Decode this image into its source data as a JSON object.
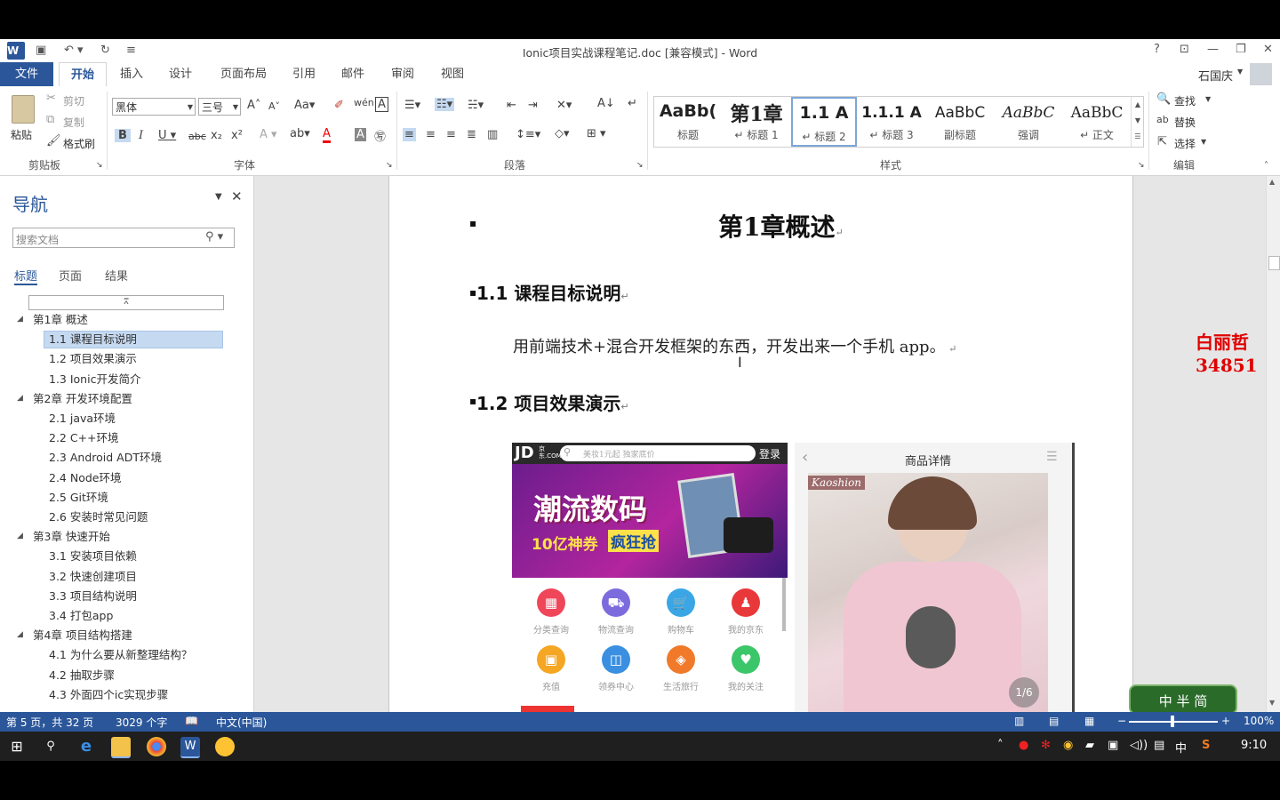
{
  "titlebar": {
    "title": "Ionic项目实战课程笔记.doc [兼容模式] - Word",
    "help": "?",
    "user": "石国庆"
  },
  "ribbon_tabs": [
    "文件",
    "开始",
    "插入",
    "设计",
    "页面布局",
    "引用",
    "邮件",
    "审阅",
    "视图"
  ],
  "clipboard": {
    "paste": "粘贴",
    "cut": "剪切",
    "copy": "复制",
    "format_painter": "格式刷",
    "label": "剪贴板"
  },
  "font": {
    "name": "黑体",
    "size": "三号",
    "label": "字体"
  },
  "paragraph": {
    "label": "段落"
  },
  "styles": {
    "label": "样式",
    "items": [
      {
        "preview": "AaBb(",
        "name": "标题"
      },
      {
        "preview": "第1章",
        "name": "↵ 标题 1"
      },
      {
        "preview": "1.1 A",
        "name": "↵ 标题 2"
      },
      {
        "preview": "1.1.1 A",
        "name": "↵ 标题 3"
      },
      {
        "preview": "AaBbC",
        "name": "副标题"
      },
      {
        "preview": "AaBbC",
        "name": "强调"
      },
      {
        "preview": "AaBbC",
        "name": "↵ 正文"
      }
    ]
  },
  "editing": {
    "find": "查找",
    "replace": "替换",
    "select": "选择",
    "label": "编辑"
  },
  "nav": {
    "title": "导航",
    "search_placeholder": "搜索文档",
    "tabs": [
      "标题",
      "页面",
      "结果"
    ],
    "tree": [
      {
        "text": "第1章 概述",
        "level": 0
      },
      {
        "text": "1.1 课程目标说明",
        "level": 1,
        "selected": true
      },
      {
        "text": "1.2 项目效果演示",
        "level": 1
      },
      {
        "text": "1.3 Ionic开发简介",
        "level": 1
      },
      {
        "text": "第2章 开发环境配置",
        "level": 0
      },
      {
        "text": "2.1 java环境",
        "level": 1
      },
      {
        "text": "2.2 C++环境",
        "level": 1
      },
      {
        "text": "2.3 Android ADT环境",
        "level": 1
      },
      {
        "text": "2.4 Node环境",
        "level": 1
      },
      {
        "text": "2.5 Git环境",
        "level": 1
      },
      {
        "text": "2.6 安装时常见问题",
        "level": 1
      },
      {
        "text": "第3章 快速开始",
        "level": 0
      },
      {
        "text": "3.1 安装项目依赖",
        "level": 1
      },
      {
        "text": "3.2 快速创建项目",
        "level": 1
      },
      {
        "text": "3.3 项目结构说明",
        "level": 1
      },
      {
        "text": "3.4 打包app",
        "level": 1
      },
      {
        "text": "第4章 项目结构搭建",
        "level": 0
      },
      {
        "text": "4.1 为什么要从新整理结构？",
        "level": 1
      },
      {
        "text": "4.2 抽取步骤",
        "level": 1
      },
      {
        "text": "4.3 外面四个ic实现步骤",
        "level": 1
      }
    ]
  },
  "document": {
    "chapter_title": "第1章概述",
    "h2_1": "1.1  课程目标说明",
    "paragraph": "用前端技术+混合开发框架的东西，开发出来一个手机 app。",
    "h2_2": "1.2  项目效果演示"
  },
  "embedded": {
    "jd_logo": "JD",
    "jd_logo_small": "京东.COM",
    "jd_search": "美妆1元起 独家底价",
    "jd_login": "登录",
    "banner_main": "潮流数码",
    "banner_sub1": "10亿神券",
    "banner_sub2": "疯狂抢",
    "icons": [
      {
        "label": "分类查询",
        "color": "#f0465a"
      },
      {
        "label": "物流查询",
        "color": "#7b6bdc"
      },
      {
        "label": "购物车",
        "color": "#3aa6e6"
      },
      {
        "label": "我的京东",
        "color": "#e9383a"
      },
      {
        "label": "充值",
        "color": "#f5a623"
      },
      {
        "label": "领券中心",
        "color": "#3b8fe0"
      },
      {
        "label": "生活旅行",
        "color": "#f07a2a"
      },
      {
        "label": "我的关注",
        "color": "#3cc66a"
      }
    ],
    "detail_title": "商品详情",
    "brand": "Kaoshion",
    "page_indicator": "1/6"
  },
  "watermark": {
    "line1": "白丽哲",
    "line2": "34851"
  },
  "ime": "中 半 简",
  "statusbar": {
    "page": "第 5 页，共 32 页",
    "words": "3029 个字",
    "language": "中文(中国)",
    "zoom": "100%"
  },
  "taskbar": {
    "clock": "9:10",
    "ime_indicator": "中"
  },
  "colors": {
    "word_blue": "#2b579a",
    "watermark_red": "#e00000"
  }
}
